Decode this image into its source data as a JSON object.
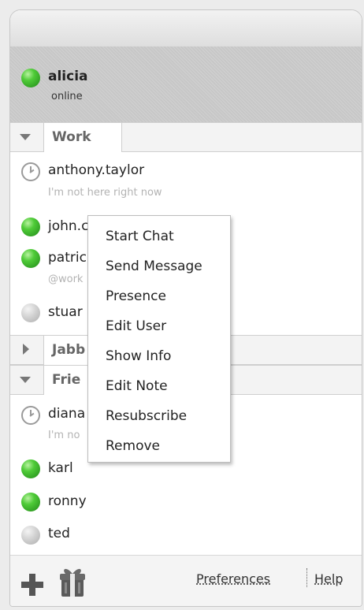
{
  "user": {
    "name": "alicia",
    "status": "online"
  },
  "groups": [
    {
      "name": "Work",
      "expanded": true
    },
    {
      "name": "Jabb",
      "expanded": false
    },
    {
      "name": "Frie",
      "expanded": true
    }
  ],
  "work_contacts": [
    {
      "name": "anthony.taylor",
      "status_text": "I'm not here right now",
      "presence": "away"
    },
    {
      "name": "john.c",
      "status_text": "",
      "presence": "online"
    },
    {
      "name": "patric",
      "status_text": "@work",
      "presence": "online"
    },
    {
      "name": "stuar",
      "status_text": "",
      "presence": "offline"
    }
  ],
  "friends_contacts": [
    {
      "name": "diana",
      "status_text": "I'm no",
      "presence": "away"
    },
    {
      "name": "karl",
      "status_text": "",
      "presence": "online"
    },
    {
      "name": "ronny",
      "status_text": "",
      "presence": "online"
    },
    {
      "name": "ted",
      "status_text": "",
      "presence": "offline"
    }
  ],
  "context_menu": {
    "items": [
      "Start Chat",
      "Send Message",
      "Presence",
      "Edit User",
      "Show Info",
      "Edit Note",
      "Resubscribe",
      "Remove"
    ]
  },
  "footer": {
    "preferences_label": "Preferences",
    "help_label": "Help",
    "add_icon": "plus-icon",
    "gift_icon": "gift-icon"
  },
  "colors": {
    "online": "#3fb82d",
    "offline": "#c8c8c8",
    "away": "#9a9a9a"
  }
}
